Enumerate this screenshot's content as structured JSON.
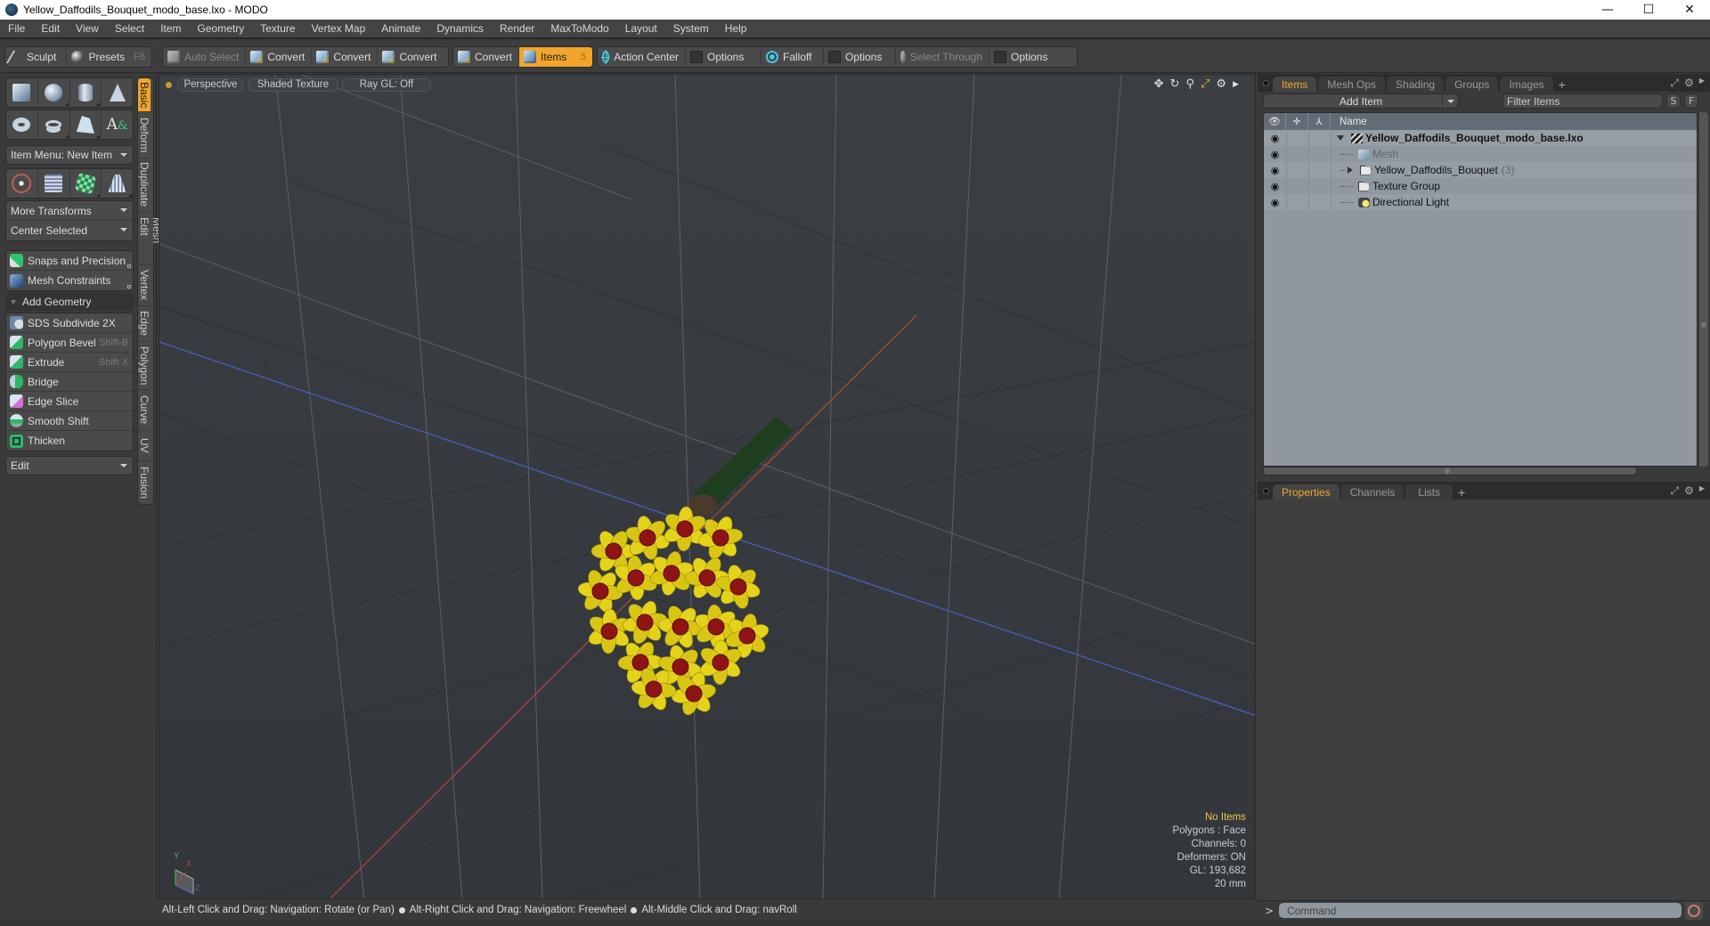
{
  "window": {
    "title": "Yellow_Daffodils_Bouquet_modo_base.lxo - MODO",
    "controls": {
      "minimize": "—",
      "maximize": "☐",
      "close": "✕"
    }
  },
  "menubar": {
    "items": [
      "File",
      "Edit",
      "View",
      "Select",
      "Item",
      "Geometry",
      "Texture",
      "Vertex Map",
      "Animate",
      "Dynamics",
      "Render",
      "MaxToModo",
      "Layout",
      "System",
      "Help"
    ]
  },
  "toolbar": {
    "sculpt": "Sculpt",
    "presets": "Presets",
    "presets_hint": "F6",
    "auto_select": "Auto Select",
    "convert1": "Convert",
    "convert2": "Convert",
    "convert3": "Convert",
    "convert4": "Convert",
    "items": "Items",
    "items_hint": "5",
    "action_center": "Action Center",
    "options1": "Options",
    "falloff": "Falloff",
    "options2": "Options",
    "select_through": "Select Through",
    "options3": "Options"
  },
  "leftpanel": {
    "item_menu": "Item Menu: New Item",
    "more_transforms": "More Transforms",
    "center_selected": "Center Selected",
    "snaps": "Snaps and Precision",
    "constraints": "Mesh Constraints",
    "add_geometry": "Add Geometry",
    "tools": [
      {
        "label": "SDS Subdivide 2X",
        "shortcut": ""
      },
      {
        "label": "Polygon Bevel",
        "shortcut": "Shift-B"
      },
      {
        "label": "Extrude",
        "shortcut": "Shift-X"
      },
      {
        "label": "Bridge",
        "shortcut": ""
      },
      {
        "label": "Edge Slice",
        "shortcut": ""
      },
      {
        "label": "Smooth Shift",
        "shortcut": ""
      },
      {
        "label": "Thicken",
        "shortcut": ""
      }
    ],
    "edit_dropdown": "Edit",
    "vtabs": [
      "Basic",
      "Deform",
      "Duplicate",
      "Mesh Edit",
      "Vertex",
      "Edge",
      "Polygon",
      "Curve",
      "UV",
      "Fusion"
    ],
    "active_vtab": "Basic"
  },
  "viewport": {
    "view": "Perspective",
    "shading": "Shaded Texture",
    "raygl": "Ray GL: Off",
    "axis_labels": {
      "plus_x": "+X",
      "minus_z": "-Z"
    },
    "gizmo_labels": {
      "x": "X",
      "y": "Y",
      "z": "Z"
    },
    "info": {
      "selection": "No Items",
      "polygons": "Polygons : Face",
      "channels": "Channels: 0",
      "deformers": "Deformers: ON",
      "gl": "GL: 193,682",
      "units": "20 mm"
    },
    "colors": {
      "x_axis": "#b8463d",
      "z_axis": "#4a5fc9",
      "petal": "#e5d21a",
      "corona": "#8e1414",
      "stem": "#1f3d1f"
    }
  },
  "statusbar": {
    "hint1": "Alt-Left Click and Drag: Navigation: Rotate (or Pan)",
    "hint2": "Alt-Right Click and Drag: Navigation: Freewheel",
    "hint3": "Alt-Middle Click and Drag: navRoll"
  },
  "itemspanel": {
    "tabs": [
      "Items",
      "Mesh Ops",
      "Shading",
      "Groups",
      "Images"
    ],
    "active_tab": "Items",
    "add_item": "Add Item",
    "filter_placeholder": "Filter Items",
    "s_btn": "S",
    "f_btn": "F",
    "column_name": "Name",
    "rows": [
      {
        "name": "Yellow_Daffodils_Bouquet_modo_base.lxo",
        "type": "scene",
        "count": ""
      },
      {
        "name": "Mesh",
        "type": "mesh",
        "count": ""
      },
      {
        "name": "Yellow_Daffodils_Bouquet",
        "type": "group",
        "count": "(3)"
      },
      {
        "name": "Texture Group",
        "type": "group",
        "count": ""
      },
      {
        "name": "Directional Light",
        "type": "light",
        "count": ""
      }
    ]
  },
  "propertiespanel": {
    "tabs": [
      "Properties",
      "Channels",
      "Lists"
    ],
    "active_tab": "Properties"
  },
  "commandbar": {
    "prompt": ">",
    "placeholder": "Command"
  },
  "accent": "#f2a52a"
}
